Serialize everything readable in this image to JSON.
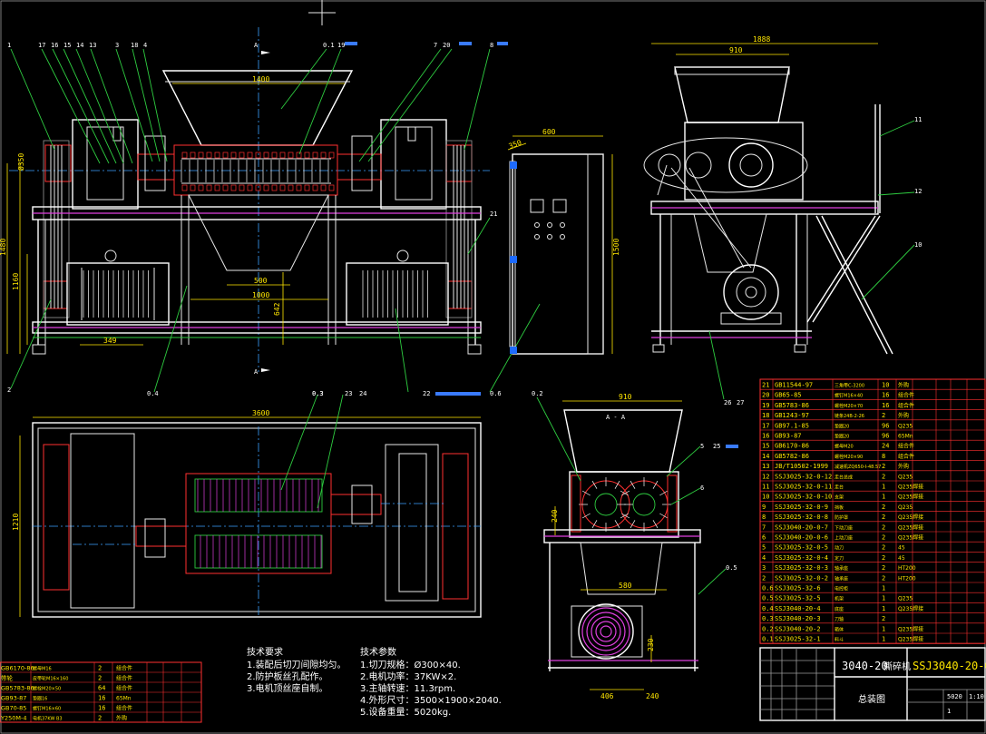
{
  "callouts_front": [
    "1",
    "17",
    "16",
    "15",
    "14",
    "13",
    "3",
    "18",
    "4",
    "0.1",
    "19",
    "7",
    "20",
    "8",
    "21",
    "2",
    "0.4",
    "0.3",
    "22",
    "0.6"
  ],
  "callouts_side": [
    "11",
    "12",
    "10",
    "26",
    "27"
  ],
  "callouts_plan": [
    "0.3",
    "23",
    "24"
  ],
  "callouts_section": [
    "0.2",
    "5",
    "25",
    "6",
    "0.5"
  ],
  "section_marks": {
    "a1": "A",
    "a2": "A",
    "aa": "A - A"
  },
  "dims": {
    "front_hopper": "1400",
    "front_h1": "Ø350",
    "front_h2": "1480",
    "front_h3": "1160",
    "front_motor": "349",
    "front_inner": "500",
    "front_inner2": "1000",
    "front_h4": "642",
    "cabinet_w": "600",
    "cabinet_h": "1500",
    "cabinet_d": "350",
    "side_total": "1888",
    "side_hopper": "910",
    "plan_total": "3600",
    "plan_h": "1210",
    "sec_top": "910",
    "sec_mid": "240",
    "sec_low": "580",
    "sec_base": "406",
    "sec_b2": "240",
    "sec_b3": "230"
  },
  "tech_req": {
    "title": "技术要求",
    "lines": [
      "1.装配后切刀间隙均匀。",
      "2.防护板丝孔配作。",
      "3.电机顶丝座自制。"
    ]
  },
  "tech_param": {
    "title": "技术参数",
    "lines": [
      "1.切刀规格：Ø300×40.",
      "2.电机功率：37KW×2.",
      "3.主轴转速：11.3rpm.",
      "4.外形尺寸：3500×1900×2040.",
      "5.设备重量：5020kg."
    ]
  },
  "bom_right": [
    {
      "no": "21",
      "code": "GB11544-97",
      "name": "三角带C-3200",
      "qty": "10",
      "mat": "外购"
    },
    {
      "no": "20",
      "code": "GB65-85",
      "name": "螺钉M16×40",
      "qty": "16",
      "mat": "组合件"
    },
    {
      "no": "19",
      "code": "GB5783-86",
      "name": "螺栓M20×70",
      "qty": "16",
      "mat": "组合件"
    },
    {
      "no": "18",
      "code": "GB1243-97",
      "name": "链条24B-2-26",
      "qty": "2",
      "mat": "外购"
    },
    {
      "no": "17",
      "code": "GB97.1-85",
      "name": "垫圈20",
      "qty": "96",
      "mat": "Q235"
    },
    {
      "no": "16",
      "code": "GB93-87",
      "name": "垫圈20",
      "qty": "96",
      "mat": "65Mn"
    },
    {
      "no": "15",
      "code": "GB6170-86",
      "name": "螺母M20",
      "qty": "24",
      "mat": "组合件"
    },
    {
      "no": "14",
      "code": "GB5782-86",
      "name": "螺栓M20×90",
      "qty": "8",
      "mat": "组合件"
    },
    {
      "no": "13",
      "code": "JB/T10502-1999",
      "name": "减速机ZQ650-I-48.57",
      "qty": "2",
      "mat": "外购"
    },
    {
      "no": "12",
      "code": "SSJ3025-32-0-12",
      "name": "走台总成",
      "qty": "2",
      "mat": "Q235"
    },
    {
      "no": "11",
      "code": "SSJ3025-32-0-11",
      "name": "走台",
      "qty": "1",
      "mat": "Q235焊接"
    },
    {
      "no": "10",
      "code": "SSJ3025-32-0-10",
      "name": "支架",
      "qty": "1",
      "mat": "Q235焊接"
    },
    {
      "no": "9",
      "code": "SSJ3025-32-0-9",
      "name": "挡板",
      "qty": "2",
      "mat": "Q235"
    },
    {
      "no": "8",
      "code": "SSJ3025-32-0-8",
      "name": "防护罩",
      "qty": "2",
      "mat": "Q235焊接"
    },
    {
      "no": "7",
      "code": "SSJ3040-20-0-7",
      "name": "下动刀座",
      "qty": "2",
      "mat": "Q235焊接"
    },
    {
      "no": "6",
      "code": "SSJ3040-20-0-6",
      "name": "上动刀座",
      "qty": "2",
      "mat": "Q235焊接"
    },
    {
      "no": "5",
      "code": "SSJ3025-32-0-5",
      "name": "动刀",
      "qty": "2",
      "mat": "45"
    },
    {
      "no": "4",
      "code": "SSJ3025-32-0-4",
      "name": "定刀",
      "qty": "2",
      "mat": "45"
    },
    {
      "no": "3",
      "code": "SSJ3025-32-0-3",
      "name": "轴承座",
      "qty": "2",
      "mat": "HT200"
    },
    {
      "no": "2",
      "code": "SSJ3025-32-0-2",
      "name": "轴承座",
      "qty": "2",
      "mat": "HT200"
    },
    {
      "no": "0.6",
      "code": "SSJ3025-32-6",
      "name": "电控柜",
      "qty": "1",
      "mat": ""
    },
    {
      "no": "0.5",
      "code": "SSJ3025-32-5",
      "name": "机架",
      "qty": "1",
      "mat": "Q235"
    },
    {
      "no": "0.4",
      "code": "SSJ3040-20-4",
      "name": "底座",
      "qty": "1",
      "mat": "Q235焊接"
    },
    {
      "no": "0.3",
      "code": "SSJ3040-20-3",
      "name": "刀轴",
      "qty": "2",
      "mat": ""
    },
    {
      "no": "0.2",
      "code": "SSJ3040-20-2",
      "name": "箱体",
      "qty": "1",
      "mat": "Q235焊接"
    },
    {
      "no": "0.1",
      "code": "SSJ3025-32-1",
      "name": "料斗",
      "qty": "1",
      "mat": "Q235焊接"
    }
  ],
  "bom_left": [
    {
      "code": "GB6170-86",
      "name": "螺母M16",
      "qty": "2",
      "mat": "组合件"
    },
    {
      "code": "带轮",
      "name": "皮带轮M16×160",
      "qty": "2",
      "mat": "组合件"
    },
    {
      "code": "GB5783-86",
      "name": "螺栓M20×50",
      "qty": "64",
      "mat": "组合件"
    },
    {
      "code": "GB93-87",
      "name": "垫圈16",
      "qty": "16",
      "mat": "65Mn"
    },
    {
      "code": "GB70-85",
      "name": "螺钉M16×60",
      "qty": "16",
      "mat": "组合件"
    },
    {
      "code": "Y250M-4",
      "name": "电机37KW B3",
      "qty": "2",
      "mat": "外购"
    }
  ],
  "title_block": {
    "model": "3040-20",
    "name": "撕碎机",
    "drawing_no": "SSJ3040-20-0",
    "sheet_title": "总装图",
    "weight": "5020",
    "scale": "1:10",
    "sheets": "1"
  }
}
